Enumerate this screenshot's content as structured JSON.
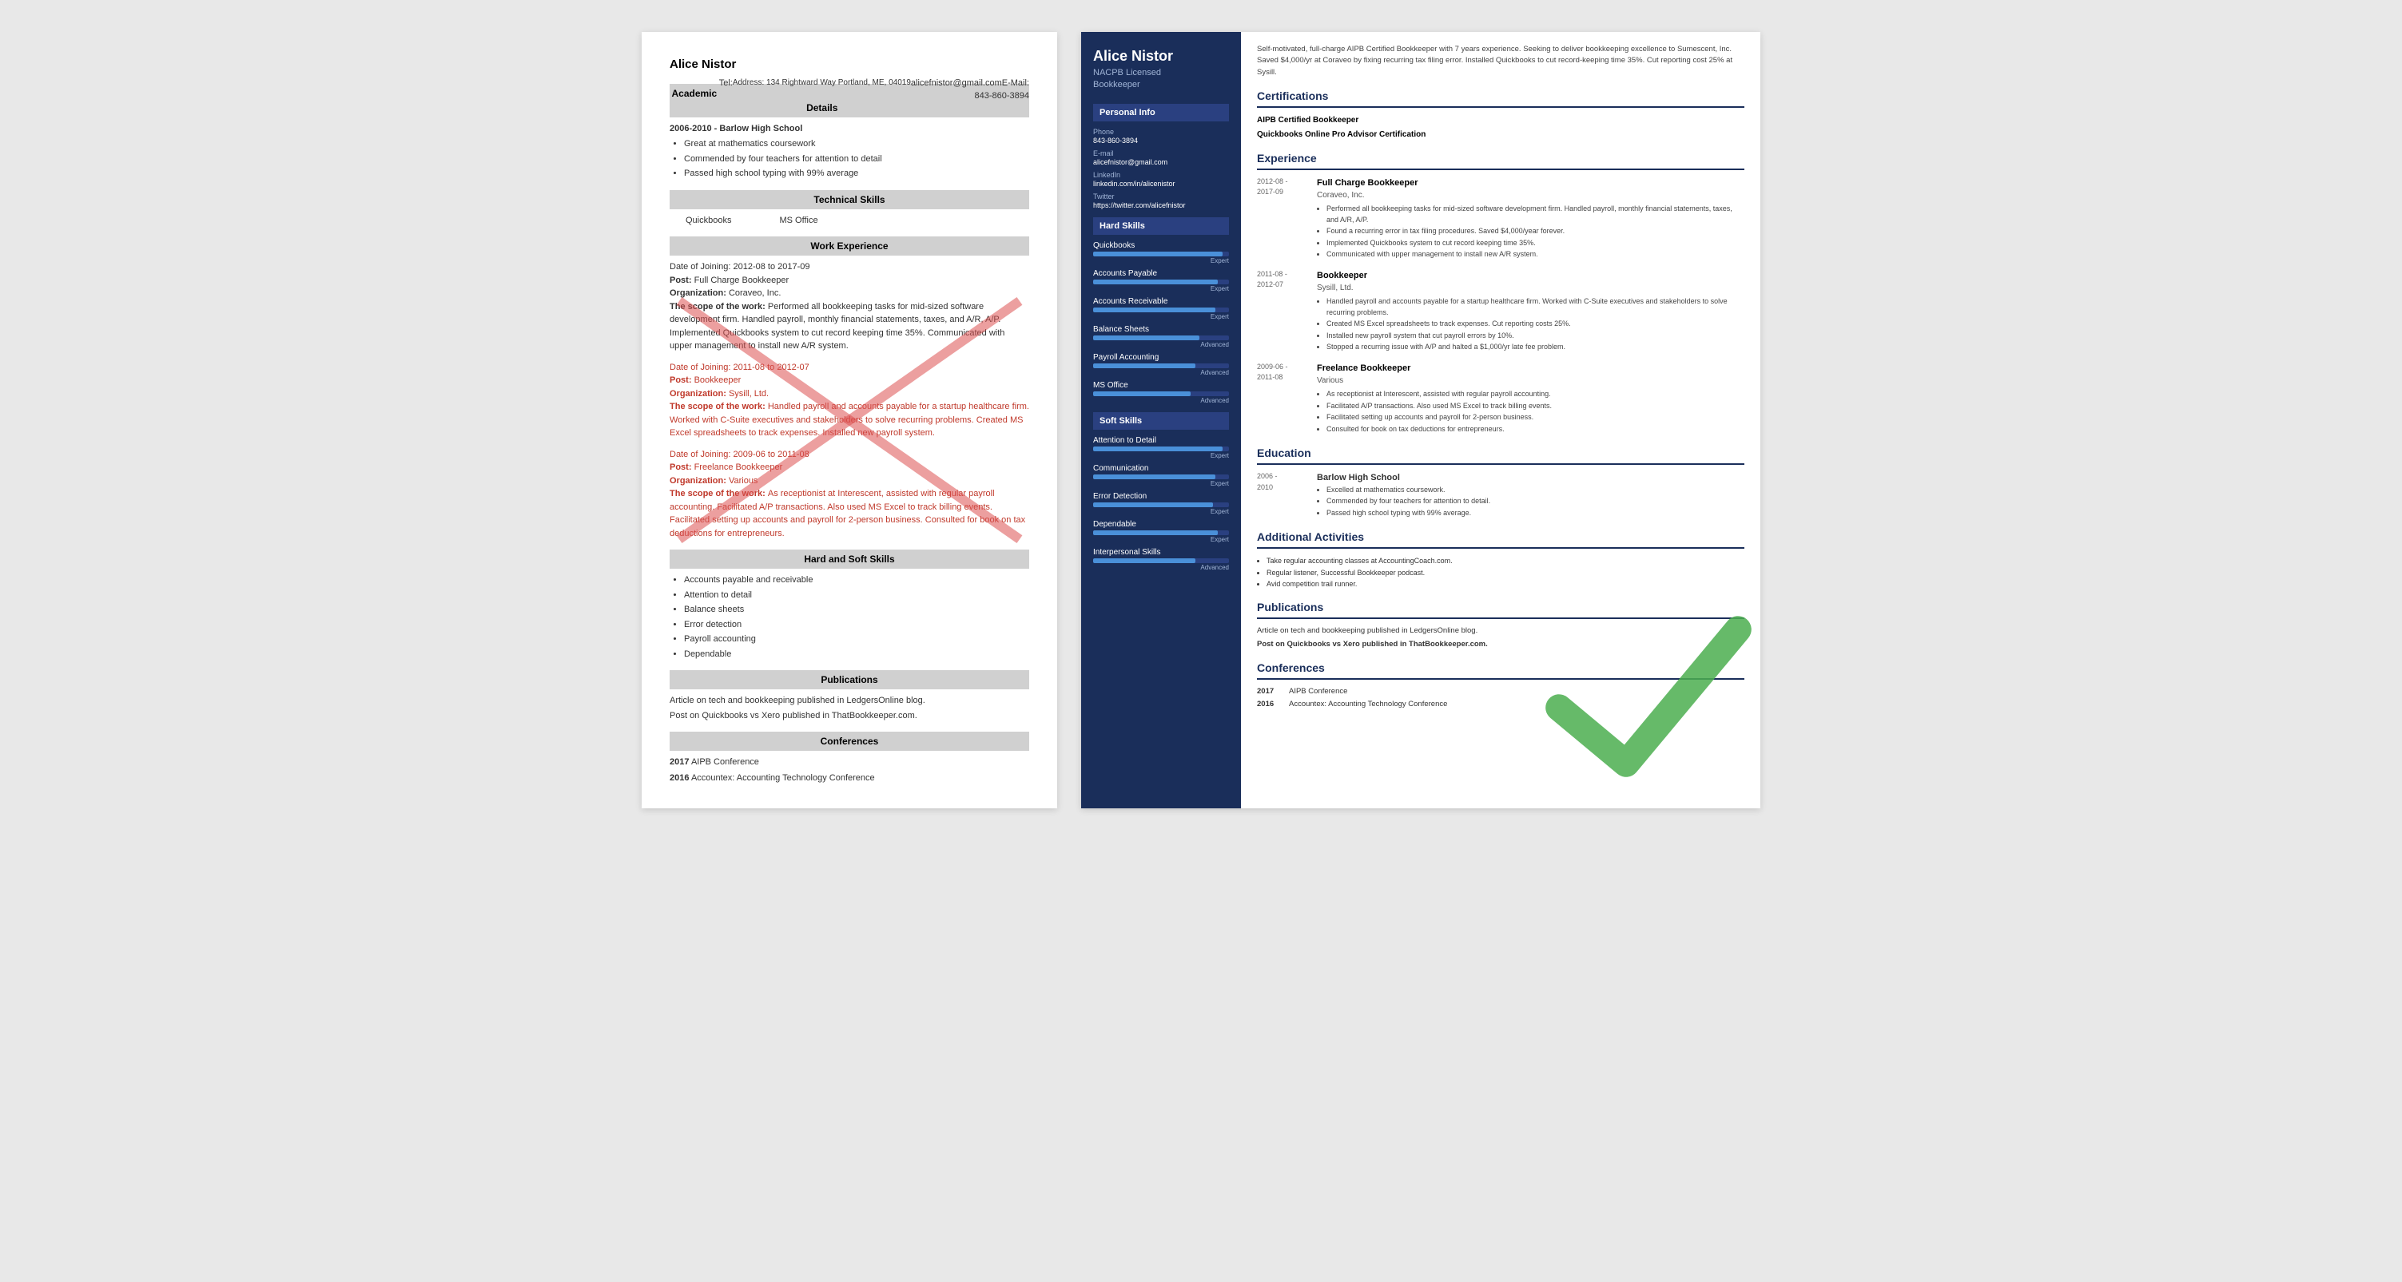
{
  "left": {
    "name": "Alice Nistor",
    "email_label": "E-Mail:",
    "email": "alicefnistor@gmail.com",
    "tel_label": "Tel:",
    "tel": "843-860-3894",
    "address_label": "Address:",
    "address": "134 Rightward Way Portland, ME, 04019",
    "sections": {
      "academic": {
        "title": "Academic Details",
        "school": "2006-2010 - Barlow High School",
        "bullets": [
          "Great at mathematics coursework",
          "Commended by four teachers for attention to detail",
          "Passed high school typing with 99% average"
        ]
      },
      "technical": {
        "title": "Technical Skills",
        "skills": [
          "Quickbooks",
          "MS Office"
        ]
      },
      "work": {
        "title": "Work Experience",
        "entries": [
          {
            "dates": "Date of Joining: 2012-08 to 2017-09",
            "post": "Post: Full Charge Bookkeeper",
            "org": "Organization: Coraveo, Inc.",
            "scope_label": "The scope of the work:",
            "scope": "Performed all bookkeeping tasks for mid-sized software development firm. Handled payroll, monthly financial statements, taxes, and A/R, A/P. Implemented Quickbooks system to cut record keeping time 35%. Communicated with upper management to install new A/R system.",
            "highlighted": false
          },
          {
            "dates": "Date of Joining: 2011-08 to 2012-07",
            "post": "Post: Bookkeeper",
            "org": "Organization: Sysill, Ltd.",
            "scope_label": "The scope of the work:",
            "scope": "Handled payroll and accounts payable for a startup healthcare firm. Worked with C-Suite executives and stakeholders to solve recurring problems. Created MS Excel spreadsheets to track expenses. Installed new payroll system.",
            "highlighted": true
          },
          {
            "dates": "Date of Joining: 2009-06 to 2011-08",
            "post": "Post: Freelance Bookkeeper",
            "org": "Organization: Various",
            "scope_label": "The scope of the work:",
            "scope": "As receptionist at Interescent, assisted with regular payroll accounting. Facilitated A/P transactions. Also used MS Excel to track billing events. Facilitated setting up accounts and payroll for 2-person business. Consulted for book on tax deductions for entrepreneurs.",
            "highlighted": true
          }
        ]
      },
      "hard_soft": {
        "title": "Hard and Soft Skills",
        "skills": [
          "Accounts payable and receivable",
          "Attention to detail",
          "Balance sheets",
          "Error detection",
          "Payroll accounting",
          "Dependable"
        ]
      },
      "publications": {
        "title": "Publications",
        "items": [
          "Article on tech and bookkeeping published in LedgersOnline blog.",
          "Post on Quickbooks vs Xero published in ThatBookkeeper.com."
        ]
      },
      "conferences": {
        "title": "Conferences",
        "items": [
          {
            "year": "2017",
            "name": "AIPB Conference"
          },
          {
            "year": "2016",
            "name": "Accountex: Accounting Technology Conference"
          }
        ]
      }
    }
  },
  "right": {
    "name": "Alice Nistor",
    "title_line1": "NACPB Licensed",
    "title_line2": "Bookkeeper",
    "summary": "Self-motivated, full-charge AIPB Certified Bookkeeper with 7 years experience. Seeking to deliver bookkeeping excellence to Sumescent, Inc. Saved $4,000/yr at Coraveo by fixing recurring tax filing error. Installed Quickbooks to cut record-keeping time 35%. Cut reporting cost 25% at Sysill.",
    "sidebar": {
      "personal_info_title": "Personal Info",
      "phone_label": "Phone",
      "phone": "843-860-3894",
      "email_label": "E-mail",
      "email": "alicefnistor@gmail.com",
      "linkedin_label": "LinkedIn",
      "linkedin": "linkedin.com/in/alicenistor",
      "twitter_label": "Twitter",
      "twitter": "https://twitter.com/alicefnistor",
      "hard_skills_title": "Hard Skills",
      "hard_skills": [
        {
          "name": "Quickbooks",
          "level": "Expert",
          "pct": 95
        },
        {
          "name": "Accounts Payable",
          "level": "Expert",
          "pct": 92
        },
        {
          "name": "Accounts Receivable",
          "level": "Expert",
          "pct": 90
        },
        {
          "name": "Balance Sheets",
          "level": "Advanced",
          "pct": 78
        },
        {
          "name": "Payroll Accounting",
          "level": "Advanced",
          "pct": 75
        },
        {
          "name": "MS Office",
          "level": "Advanced",
          "pct": 72
        }
      ],
      "soft_skills_title": "Soft Skills",
      "soft_skills": [
        {
          "name": "Attention to Detail",
          "level": "Expert",
          "pct": 95
        },
        {
          "name": "Communication",
          "level": "Expert",
          "pct": 90
        },
        {
          "name": "Error Detection",
          "level": "Expert",
          "pct": 88
        },
        {
          "name": "Dependable",
          "level": "Expert",
          "pct": 92
        },
        {
          "name": "Interpersonal Skills",
          "level": "Advanced",
          "pct": 75
        }
      ]
    },
    "certifications": {
      "title": "Certifications",
      "items": [
        "AIPB Certified Bookkeeper",
        "Quickbooks Online Pro Advisor Certification"
      ]
    },
    "experience": {
      "title": "Experience",
      "entries": [
        {
          "dates": "2012-08 -\n2017-09",
          "job_title": "Full Charge Bookkeeper",
          "company": "Coraveo, Inc.",
          "bullets": [
            "Performed all bookkeeping tasks for mid-sized software development firm. Handled payroll, monthly financial statements, taxes, and A/R, A/P.",
            "Found a recurring error in tax filing procedures. Saved $4,000/year forever.",
            "Implemented Quickbooks system to cut record keeping time 35%.",
            "Communicated with upper management to install new A/R system."
          ]
        },
        {
          "dates": "2011-08 -\n2012-07",
          "job_title": "Bookkeeper",
          "company": "Sysill, Ltd.",
          "bullets": [
            "Handled payroll and accounts payable for a startup healthcare firm. Worked with C-Suite executives and stakeholders to solve recurring problems.",
            "Created MS Excel spreadsheets to track expenses. Cut reporting costs 25%.",
            "Installed new payroll system that cut payroll errors by 10%.",
            "Stopped a recurring issue with A/P and halted a $1,000/yr late fee problem."
          ]
        },
        {
          "dates": "2009-06 -\n2011-08",
          "job_title": "Freelance Bookkeeper",
          "company": "Various",
          "bullets": [
            "As receptionist at Interescent, assisted with regular payroll accounting.",
            "Facilitated A/P transactions. Also used MS Excel to track billing events.",
            "Facilitated setting up accounts and payroll for 2-person business.",
            "Consulted for book on tax deductions for entrepreneurs."
          ]
        }
      ]
    },
    "education": {
      "title": "Education",
      "entries": [
        {
          "dates": "2006 -\n2010",
          "school": "Barlow High School",
          "bullets": [
            "Excelled at mathematics coursework.",
            "Commended by four teachers for attention to detail.",
            "Passed high school typing with 99% average."
          ]
        }
      ]
    },
    "additional": {
      "title": "Additional Activities",
      "bullets": [
        "Take regular accounting classes at AccountingCoach.com.",
        "Regular listener, Successful Bookkeeper podcast.",
        "Avid competition trail runner."
      ]
    },
    "publications": {
      "title": "Publications",
      "items": [
        "Article on tech and bookkeeping published in LedgersOnline blog.",
        "Post on Quickbooks vs Xero published in ThatBookkeeper.com."
      ]
    },
    "conferences": {
      "title": "Conferences",
      "items": [
        {
          "year": "2017",
          "name": "AIPB Conference"
        },
        {
          "year": "2016",
          "name": "Accountex: Accounting Technology Conference"
        }
      ]
    }
  }
}
